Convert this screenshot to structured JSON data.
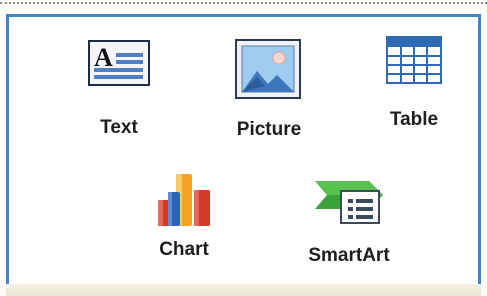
{
  "panel": {
    "items": [
      {
        "id": "text",
        "label": "Text",
        "icon": "text-box-icon"
      },
      {
        "id": "picture",
        "label": "Picture",
        "icon": "picture-icon"
      },
      {
        "id": "table",
        "label": "Table",
        "icon": "table-icon"
      },
      {
        "id": "chart",
        "label": "Chart",
        "icon": "bar-chart-icon"
      },
      {
        "id": "smartart",
        "label": "SmartArt",
        "icon": "smartart-icon"
      }
    ]
  },
  "colors": {
    "border": "#3d85cc",
    "label": "#1e1e1e",
    "table_header": "#2f6ab3",
    "chart_red": "#d23a2a",
    "chart_orange": "#f2a623",
    "chart_blue": "#2a63b8",
    "smartart_green": "#3aa23a"
  }
}
